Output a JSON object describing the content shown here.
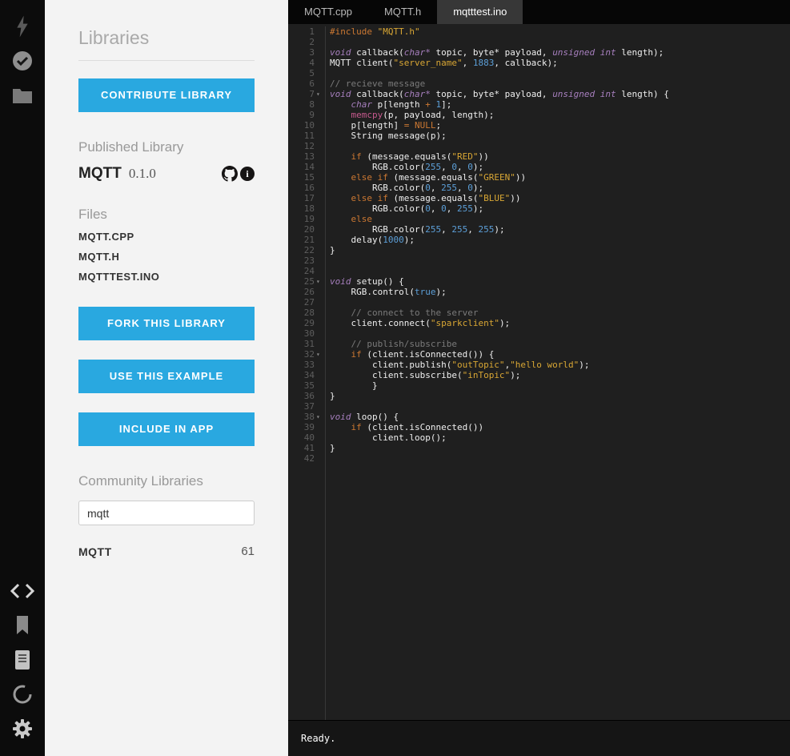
{
  "colors": {
    "accent_blue": "#29a8e0",
    "editor_bg": "#1f1f1f",
    "string": "#d8a634",
    "number": "#5c9fd8",
    "keyword": "#cc7832",
    "type": "#a77fbe",
    "comment": "#7a7a7a",
    "function": "#c75a8e"
  },
  "sidebar": {
    "top_icons": [
      "flash-icon",
      "verify-icon",
      "folder-icon"
    ],
    "bottom_icons": [
      "code-icon",
      "libraries-bookmark-icon",
      "docs-icon",
      "console-icon",
      "settings-gear-icon"
    ]
  },
  "panel": {
    "title": "Libraries",
    "contribute_button": "CONTRIBUTE LIBRARY",
    "published_heading": "Published Library",
    "library_name": "MQTT",
    "library_version": "0.1.0",
    "github_icon": "github-icon",
    "info_icon": "info-icon",
    "info_glyph": "i",
    "files_heading": "Files",
    "files": [
      "MQTT.CPP",
      "MQTT.H",
      "MQTTTEST.INO"
    ],
    "fork_button": "FORK THIS LIBRARY",
    "example_button": "USE THIS EXAMPLE",
    "include_button": "INCLUDE IN APP",
    "community_heading": "Community Libraries",
    "search_value": "mqtt",
    "results": [
      {
        "name": "MQTT",
        "count": "61"
      }
    ]
  },
  "editor": {
    "tabs": [
      {
        "label": "MQTT.cpp",
        "active": false
      },
      {
        "label": "MQTT.h",
        "active": false
      },
      {
        "label": "mqtttest.ino",
        "active": true
      }
    ],
    "status": "Ready.",
    "fold_lines": [
      7,
      25,
      32,
      38
    ],
    "code_lines": [
      [
        [
          "key",
          "#include"
        ],
        [
          "pl",
          " "
        ],
        [
          "str",
          "\"MQTT.h\""
        ]
      ],
      [],
      [
        [
          "type",
          "void"
        ],
        [
          "pl",
          " callback("
        ],
        [
          "type",
          "char*"
        ],
        [
          "pl",
          " topic, byte* payload, "
        ],
        [
          "type",
          "unsigned int"
        ],
        [
          "pl",
          " length);"
        ]
      ],
      [
        [
          "pl",
          "MQTT client("
        ],
        [
          "str",
          "\"server_name\""
        ],
        [
          "pl",
          ", "
        ],
        [
          "num",
          "1883"
        ],
        [
          "pl",
          ", callback);"
        ]
      ],
      [],
      [
        [
          "com",
          "// recieve message"
        ]
      ],
      [
        [
          "type",
          "void"
        ],
        [
          "pl",
          " callback("
        ],
        [
          "type",
          "char*"
        ],
        [
          "pl",
          " topic, byte* payload, "
        ],
        [
          "type",
          "unsigned int"
        ],
        [
          "pl",
          " length) {"
        ]
      ],
      [
        [
          "pl",
          "    "
        ],
        [
          "type",
          "char"
        ],
        [
          "pl",
          " p[length "
        ],
        [
          "key",
          "+"
        ],
        [
          "pl",
          " "
        ],
        [
          "num",
          "1"
        ],
        [
          "pl",
          "];"
        ]
      ],
      [
        [
          "pl",
          "    "
        ],
        [
          "fn",
          "memcpy"
        ],
        [
          "pl",
          "(p, payload, length);"
        ]
      ],
      [
        [
          "pl",
          "    p[length] "
        ],
        [
          "key",
          "="
        ],
        [
          "pl",
          " "
        ],
        [
          "key",
          "NULL"
        ],
        [
          "pl",
          ";"
        ]
      ],
      [
        [
          "pl",
          "    String message(p);"
        ]
      ],
      [],
      [
        [
          "pl",
          "    "
        ],
        [
          "key",
          "if"
        ],
        [
          "pl",
          " (message.equals("
        ],
        [
          "str",
          "\"RED\""
        ],
        [
          "pl",
          "))"
        ]
      ],
      [
        [
          "pl",
          "        RGB.color("
        ],
        [
          "num",
          "255"
        ],
        [
          "pl",
          ", "
        ],
        [
          "num",
          "0"
        ],
        [
          "pl",
          ", "
        ],
        [
          "num",
          "0"
        ],
        [
          "pl",
          ");"
        ]
      ],
      [
        [
          "pl",
          "    "
        ],
        [
          "key",
          "else"
        ],
        [
          "pl",
          " "
        ],
        [
          "key",
          "if"
        ],
        [
          "pl",
          " (message.equals("
        ],
        [
          "str",
          "\"GREEN\""
        ],
        [
          "pl",
          "))"
        ]
      ],
      [
        [
          "pl",
          "        RGB.color("
        ],
        [
          "num",
          "0"
        ],
        [
          "pl",
          ", "
        ],
        [
          "num",
          "255"
        ],
        [
          "pl",
          ", "
        ],
        [
          "num",
          "0"
        ],
        [
          "pl",
          ");"
        ]
      ],
      [
        [
          "pl",
          "    "
        ],
        [
          "key",
          "else"
        ],
        [
          "pl",
          " "
        ],
        [
          "key",
          "if"
        ],
        [
          "pl",
          " (message.equals("
        ],
        [
          "str",
          "\"BLUE\""
        ],
        [
          "pl",
          "))"
        ]
      ],
      [
        [
          "pl",
          "        RGB.color("
        ],
        [
          "num",
          "0"
        ],
        [
          "pl",
          ", "
        ],
        [
          "num",
          "0"
        ],
        [
          "pl",
          ", "
        ],
        [
          "num",
          "255"
        ],
        [
          "pl",
          ");"
        ]
      ],
      [
        [
          "pl",
          "    "
        ],
        [
          "key",
          "else"
        ]
      ],
      [
        [
          "pl",
          "        RGB.color("
        ],
        [
          "num",
          "255"
        ],
        [
          "pl",
          ", "
        ],
        [
          "num",
          "255"
        ],
        [
          "pl",
          ", "
        ],
        [
          "num",
          "255"
        ],
        [
          "pl",
          ");"
        ]
      ],
      [
        [
          "pl",
          "    delay("
        ],
        [
          "num",
          "1000"
        ],
        [
          "pl",
          ");"
        ]
      ],
      [
        [
          "pl",
          "}"
        ]
      ],
      [],
      [],
      [
        [
          "type",
          "void"
        ],
        [
          "pl",
          " setup() {"
        ]
      ],
      [
        [
          "pl",
          "    RGB.control("
        ],
        [
          "num",
          "true"
        ],
        [
          "pl",
          ");"
        ]
      ],
      [],
      [
        [
          "pl",
          "    "
        ],
        [
          "com",
          "// connect to the server"
        ]
      ],
      [
        [
          "pl",
          "    client.connect("
        ],
        [
          "str",
          "\"sparkclient\""
        ],
        [
          "pl",
          ");"
        ]
      ],
      [],
      [
        [
          "pl",
          "    "
        ],
        [
          "com",
          "// publish/subscribe"
        ]
      ],
      [
        [
          "pl",
          "    "
        ],
        [
          "key",
          "if"
        ],
        [
          "pl",
          " (client.isConnected()) {"
        ]
      ],
      [
        [
          "pl",
          "        client.publish("
        ],
        [
          "str",
          "\"outTopic\""
        ],
        [
          "pl",
          ","
        ],
        [
          "str",
          "\"hello world\""
        ],
        [
          "pl",
          ");"
        ]
      ],
      [
        [
          "pl",
          "        client.subscribe("
        ],
        [
          "str",
          "\"inTopic\""
        ],
        [
          "pl",
          ");"
        ]
      ],
      [
        [
          "pl",
          "        }"
        ]
      ],
      [
        [
          "pl",
          "}"
        ]
      ],
      [],
      [
        [
          "type",
          "void"
        ],
        [
          "pl",
          " loop() {"
        ]
      ],
      [
        [
          "pl",
          "    "
        ],
        [
          "key",
          "if"
        ],
        [
          "pl",
          " (client.isConnected())"
        ]
      ],
      [
        [
          "pl",
          "        client.loop();"
        ]
      ],
      [
        [
          "pl",
          "}"
        ]
      ],
      []
    ]
  }
}
